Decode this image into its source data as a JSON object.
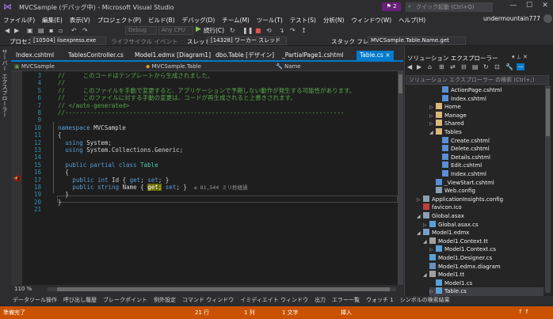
{
  "window": {
    "title": "MVCSample (デバッグ中) - Microsoft Visual Studio",
    "notification_count": "2",
    "quick_launch_placeholder": "クイック起動 (Ctrl+Q)",
    "user": "undermountain777",
    "minimize": "—",
    "maximize": "☐",
    "close": "✕"
  },
  "menu": [
    "ファイル(F)",
    "編集(E)",
    "表示(V)",
    "プロジェクト(P)",
    "ビルド(B)",
    "デバッグ(D)",
    "チーム(M)",
    "ツール(T)",
    "テスト(S)",
    "分析(N)",
    "ウィンドウ(W)",
    "ヘルプ(H)"
  ],
  "toolbar": {
    "config": "Debug",
    "platform": "Any CPU",
    "continue_label": "続行(C)"
  },
  "debug_bar": {
    "process_label": "プロセス",
    "process_value": "[10504] iisexpress.exe",
    "lifecycle_label": "ライフサイクル イベント",
    "thread_label": "スレッド",
    "thread_value": "[14328] ワーカー スレッド",
    "stackframe_label": "スタック フレーム",
    "stackframe_value": "MVCSample.Table.Name.get"
  },
  "left_tool": "サーバー エクスプローラー",
  "tabs": [
    "Index.cshtml",
    "TablesController.cs",
    "Model1.edmx [Diagram1]",
    "dbo.Table [デザイン]",
    "_PartialPage1.cshtml",
    "Table.cs"
  ],
  "active_tab_close": "×",
  "navbar": {
    "project": "MVCSample",
    "type": "MVCSample.Table",
    "member": "Name"
  },
  "code_lines": [
    {
      "n": "3",
      "text": "//     このコードはテンプレートから生成されました。"
    },
    {
      "n": "4",
      "text": "//"
    },
    {
      "n": "5",
      "text": "//     このファイルを手動で変更すると、アプリケーションで予期しない動作が発生する可能性があります。"
    },
    {
      "n": "6",
      "text": "//     このファイルに対する手動の変更は、コードが再生成されると上書きされます。"
    },
    {
      "n": "7",
      "text": "// </auto-generated>"
    },
    {
      "n": "8",
      "text": "//------------------------------------------------------------------------------"
    },
    {
      "n": "9",
      "text": ""
    },
    {
      "n": "10",
      "kw": "namespace",
      "rest": " MVCSample"
    },
    {
      "n": "11",
      "text": "{"
    },
    {
      "n": "12",
      "kw": "using",
      "rest": " System;"
    },
    {
      "n": "13",
      "kw": "using",
      "rest": " System.Collections.Generic;"
    },
    {
      "n": "14",
      "text": ""
    },
    {
      "n": "15",
      "kw": "public partial class",
      "ty": " Table"
    },
    {
      "n": "16",
      "text": "{"
    },
    {
      "n": "17",
      "kw": "public int",
      "rest": " Id { ",
      "kw2": "get",
      "rest2": "; ",
      "kw3": "set",
      "rest3": "; }"
    },
    {
      "n": "18",
      "kw": "public string",
      "rest": " Name { ",
      "hl": "get;",
      "rest2": " ",
      "kw3": "set",
      "rest3": "; }",
      "perf": "≤ 81,544 ミリ秒経過"
    },
    {
      "n": "19",
      "text": "}"
    },
    {
      "n": "20",
      "text": "}"
    },
    {
      "n": "21",
      "text": ""
    }
  ],
  "zoom": "110 %",
  "solution_explorer": {
    "title": "ソリューション エクスプローラー",
    "search_placeholder": "ソリューション エクスプローラー の検索 (Ctrl+;)",
    "items": [
      {
        "label": "ActionPage.cshtml",
        "icon": "cshtml",
        "indent": 4
      },
      {
        "label": "Index.cshtml",
        "icon": "cshtml",
        "indent": 4
      },
      {
        "label": "Home",
        "icon": "folder",
        "indent": 3,
        "expander": "▷"
      },
      {
        "label": "Manage",
        "icon": "folder",
        "indent": 3,
        "expander": "▷"
      },
      {
        "label": "Shared",
        "icon": "folder",
        "indent": 3,
        "expander": "▷"
      },
      {
        "label": "Tables",
        "icon": "folder",
        "indent": 3,
        "expander": "◢"
      },
      {
        "label": "Create.cshtml",
        "icon": "cshtml",
        "indent": 4
      },
      {
        "label": "Delete.cshtml",
        "icon": "cshtml",
        "indent": 4
      },
      {
        "label": "Details.cshtml",
        "icon": "cshtml",
        "indent": 4
      },
      {
        "label": "Edit.cshtml",
        "icon": "cshtml",
        "indent": 4
      },
      {
        "label": "Index.cshtml",
        "icon": "cshtml",
        "indent": 4
      },
      {
        "label": "_ViewStart.cshtml",
        "icon": "cshtml",
        "indent": 3
      },
      {
        "label": "Web.config",
        "icon": "cfg",
        "indent": 3
      },
      {
        "label": "ApplicationInsights.config",
        "icon": "cfg",
        "indent": 1,
        "expander": "▷"
      },
      {
        "label": "favicon.ico",
        "icon": "ico",
        "indent": 1
      },
      {
        "label": "Global.asax",
        "icon": "cfg",
        "indent": 1,
        "expander": "◢"
      },
      {
        "label": "Global.asax.cs",
        "icon": "cs",
        "indent": 2,
        "expander": "▷"
      },
      {
        "label": "Model1.edmx",
        "icon": "edmx",
        "indent": 1,
        "expander": "◢"
      },
      {
        "label": "Model1.Context.tt",
        "icon": "tt",
        "indent": 2,
        "expander": "◢"
      },
      {
        "label": "Model1.Context.cs",
        "icon": "cs",
        "indent": 3,
        "expander": "▷"
      },
      {
        "label": "Model1.Designer.cs",
        "icon": "cs",
        "indent": 2
      },
      {
        "label": "Model1.edmx.diagram",
        "icon": "diag",
        "indent": 2
      },
      {
        "label": "Model1.tt",
        "icon": "tt",
        "indent": 2,
        "expander": "◢"
      },
      {
        "label": "Model1.cs",
        "icon": "cs",
        "indent": 3
      },
      {
        "label": "Table.cs",
        "icon": "cs",
        "indent": 3,
        "expander": "▷",
        "selected": true
      }
    ]
  },
  "bottom_tabs": [
    "データツール操作",
    "呼び出し履歴",
    "ブレークポイント",
    "例外設定",
    "コマンド ウィンドウ",
    "イミディエイト ウィンドウ",
    "出力",
    "エラー一覧",
    "ウォッチ 1",
    "シンボルの検索結果"
  ],
  "status": {
    "ready": "準備完了",
    "line": "21 行",
    "col": "1 列",
    "ch": "1 文字",
    "mode": "挿入"
  },
  "colors": {
    "accent": "#007acc",
    "status_debug": "#ca5100",
    "editor_bg": "#1e1e1e",
    "comment": "#57a64a",
    "keyword": "#569cd6"
  }
}
